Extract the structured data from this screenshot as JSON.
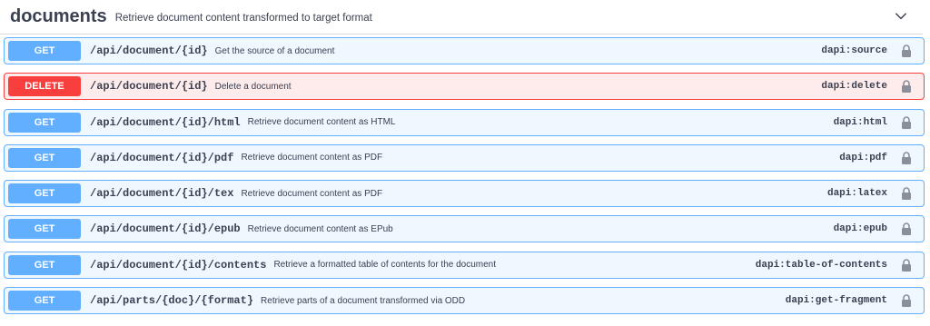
{
  "tag": {
    "name": "documents",
    "description": "Retrieve document content transformed to target format",
    "toggle_icon": "chevron-down-icon"
  },
  "colors": {
    "get": "#61affe",
    "delete": "#f93e3e",
    "text": "#3b4151"
  },
  "operations": [
    {
      "method": "GET",
      "path": "/api/document/{id}",
      "summary": "Get the source of a document",
      "scope": "dapi:source",
      "icon": "lock-icon"
    },
    {
      "method": "DELETE",
      "path": "/api/document/{id}",
      "summary": "Delete a document",
      "scope": "dapi:delete",
      "icon": "lock-icon"
    },
    {
      "method": "GET",
      "path": "/api/document/{id}/html",
      "summary": "Retrieve document content as HTML",
      "scope": "dapi:html",
      "icon": "lock-icon"
    },
    {
      "method": "GET",
      "path": "/api/document/{id}/pdf",
      "summary": "Retrieve document content as PDF",
      "scope": "dapi:pdf",
      "icon": "lock-icon"
    },
    {
      "method": "GET",
      "path": "/api/document/{id}/tex",
      "summary": "Retrieve document content as PDF",
      "scope": "dapi:latex",
      "icon": "lock-icon"
    },
    {
      "method": "GET",
      "path": "/api/document/{id}/epub",
      "summary": "Retrieve document content as EPub",
      "scope": "dapi:epub",
      "icon": "lock-icon"
    },
    {
      "method": "GET",
      "path": "/api/document/{id}/contents",
      "summary": "Retrieve a formatted table of contents for the document",
      "scope": "dapi:table-of-contents",
      "icon": "lock-icon"
    },
    {
      "method": "GET",
      "path": "/api/parts/{doc}/{format}",
      "summary": "Retrieve parts of a document transformed via ODD",
      "scope": "dapi:get-fragment",
      "icon": "lock-icon"
    }
  ]
}
